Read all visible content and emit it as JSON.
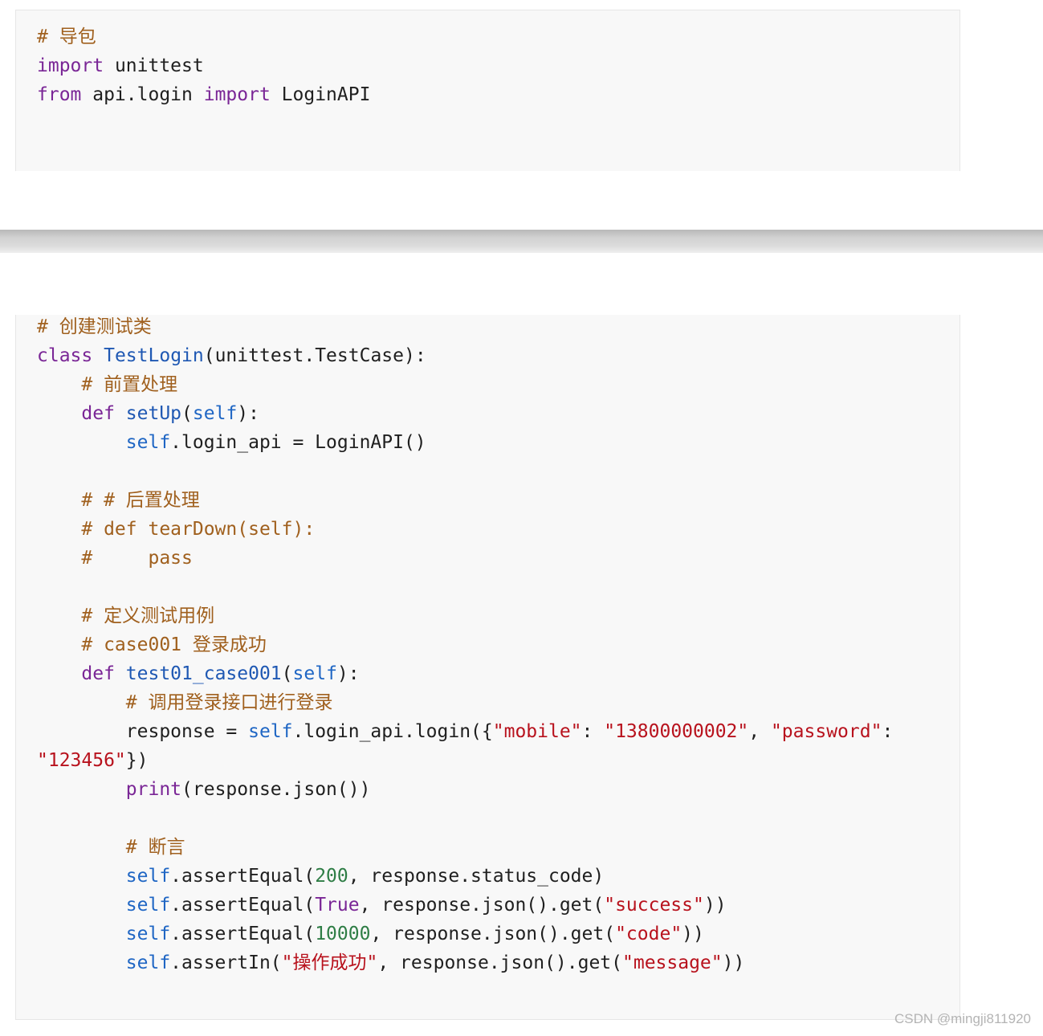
{
  "block1": {
    "lines": [
      [
        {
          "t": "# 导包",
          "k": "comment"
        }
      ],
      [
        {
          "t": "import",
          "k": "keyword"
        },
        {
          "t": " unittest",
          "k": "name"
        }
      ],
      [
        {
          "t": "from",
          "k": "keyword"
        },
        {
          "t": " api.login ",
          "k": "name"
        },
        {
          "t": "import",
          "k": "keyword"
        },
        {
          "t": " LoginAPI",
          "k": "name"
        }
      ]
    ]
  },
  "block2": {
    "lines": [
      [
        {
          "t": "# 创建测试类",
          "k": "comment"
        }
      ],
      [
        {
          "t": "class",
          "k": "keyword"
        },
        {
          "t": " ",
          "k": "name"
        },
        {
          "t": "TestLogin",
          "k": "classname"
        },
        {
          "t": "(unittest.TestCase):",
          "k": "punct"
        }
      ],
      [
        {
          "t": "    ",
          "k": "name"
        },
        {
          "t": "# 前置处理",
          "k": "comment"
        }
      ],
      [
        {
          "t": "    ",
          "k": "name"
        },
        {
          "t": "def",
          "k": "keyword"
        },
        {
          "t": " ",
          "k": "name"
        },
        {
          "t": "setUp",
          "k": "funcname"
        },
        {
          "t": "(",
          "k": "punct"
        },
        {
          "t": "self",
          "k": "self"
        },
        {
          "t": "):",
          "k": "punct"
        }
      ],
      [
        {
          "t": "        ",
          "k": "name"
        },
        {
          "t": "self",
          "k": "self"
        },
        {
          "t": ".login_api = LoginAPI()",
          "k": "name"
        }
      ],
      [],
      [
        {
          "t": "    ",
          "k": "name"
        },
        {
          "t": "# # 后置处理",
          "k": "comment"
        }
      ],
      [
        {
          "t": "    ",
          "k": "name"
        },
        {
          "t": "# def tearDown(self):",
          "k": "comment"
        }
      ],
      [
        {
          "t": "    ",
          "k": "name"
        },
        {
          "t": "#     pass",
          "k": "comment"
        }
      ],
      [],
      [
        {
          "t": "    ",
          "k": "name"
        },
        {
          "t": "# 定义测试用例",
          "k": "comment"
        }
      ],
      [
        {
          "t": "    ",
          "k": "name"
        },
        {
          "t": "# case001 登录成功",
          "k": "comment"
        }
      ],
      [
        {
          "t": "    ",
          "k": "name"
        },
        {
          "t": "def",
          "k": "keyword"
        },
        {
          "t": " ",
          "k": "name"
        },
        {
          "t": "test01_case001",
          "k": "funcname"
        },
        {
          "t": "(",
          "k": "punct"
        },
        {
          "t": "self",
          "k": "self"
        },
        {
          "t": "):",
          "k": "punct"
        }
      ],
      [
        {
          "t": "        ",
          "k": "name"
        },
        {
          "t": "# 调用登录接口进行登录",
          "k": "comment"
        }
      ],
      [
        {
          "t": "        response = ",
          "k": "name"
        },
        {
          "t": "self",
          "k": "self"
        },
        {
          "t": ".login_api.login({",
          "k": "name"
        },
        {
          "t": "\"mobile\"",
          "k": "string"
        },
        {
          "t": ": ",
          "k": "punct"
        },
        {
          "t": "\"13800000002\"",
          "k": "string"
        },
        {
          "t": ", ",
          "k": "punct"
        },
        {
          "t": "\"password\"",
          "k": "string"
        },
        {
          "t": ":",
          "k": "punct"
        }
      ],
      [
        {
          "t": "\"123456\"",
          "k": "string"
        },
        {
          "t": "})",
          "k": "punct"
        }
      ],
      [
        {
          "t": "        ",
          "k": "name"
        },
        {
          "t": "print",
          "k": "builtin"
        },
        {
          "t": "(response.json())",
          "k": "name"
        }
      ],
      [],
      [
        {
          "t": "        ",
          "k": "name"
        },
        {
          "t": "# 断言",
          "k": "comment"
        }
      ],
      [
        {
          "t": "        ",
          "k": "name"
        },
        {
          "t": "self",
          "k": "self"
        },
        {
          "t": ".assertEqual(",
          "k": "name"
        },
        {
          "t": "200",
          "k": "number"
        },
        {
          "t": ", response.status_code)",
          "k": "name"
        }
      ],
      [
        {
          "t": "        ",
          "k": "name"
        },
        {
          "t": "self",
          "k": "self"
        },
        {
          "t": ".assertEqual(",
          "k": "name"
        },
        {
          "t": "True",
          "k": "const"
        },
        {
          "t": ", response.json().get(",
          "k": "name"
        },
        {
          "t": "\"success\"",
          "k": "string"
        },
        {
          "t": "))",
          "k": "punct"
        }
      ],
      [
        {
          "t": "        ",
          "k": "name"
        },
        {
          "t": "self",
          "k": "self"
        },
        {
          "t": ".assertEqual(",
          "k": "name"
        },
        {
          "t": "10000",
          "k": "number"
        },
        {
          "t": ", response.json().get(",
          "k": "name"
        },
        {
          "t": "\"code\"",
          "k": "string"
        },
        {
          "t": "))",
          "k": "punct"
        }
      ],
      [
        {
          "t": "        ",
          "k": "name"
        },
        {
          "t": "self",
          "k": "self"
        },
        {
          "t": ".assertIn(",
          "k": "name"
        },
        {
          "t": "\"操作成功\"",
          "k": "string"
        },
        {
          "t": ", response.json().get(",
          "k": "name"
        },
        {
          "t": "\"message\"",
          "k": "string"
        },
        {
          "t": "))",
          "k": "punct"
        }
      ]
    ]
  },
  "watermark": "CSDN @mingji811920"
}
